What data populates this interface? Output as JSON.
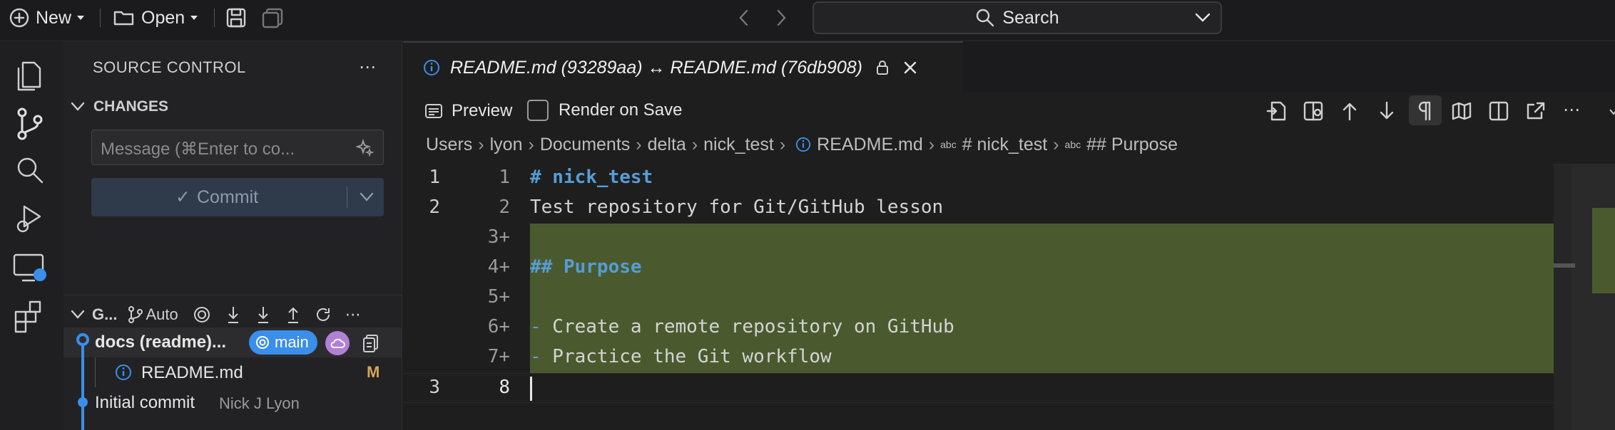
{
  "topbar": {
    "new_label": "New",
    "open_label": "Open",
    "search_label": "Search"
  },
  "sidebar": {
    "title": "SOURCE CONTROL",
    "changes_label": "CHANGES",
    "message_placeholder": "Message (⌘Enter to co...",
    "commit_label": "Commit",
    "graph_label": "G...",
    "auto_label": "Auto",
    "graph": {
      "commits": [
        {
          "title": "docs (readme)...",
          "branch": "main"
        },
        {
          "title": "Initial commit",
          "author": "Nick J Lyon"
        }
      ],
      "file": {
        "name": "README.md",
        "status": "M"
      }
    }
  },
  "editor": {
    "tab_title": "README.md (93289aa) ↔ README.md (76db908)",
    "toolbar": {
      "preview_label": "Preview",
      "render_on_save_label": "Render on Save"
    },
    "breadcrumbs": [
      "Users",
      "lyon",
      "Documents",
      "delta",
      "nick_test",
      "README.md",
      "# nick_test",
      "## Purpose"
    ],
    "lines": [
      {
        "left": "1",
        "right": "1",
        "text": "# nick_test",
        "added": false,
        "kind": "h1"
      },
      {
        "left": "2",
        "right": "2",
        "text": "Test repository for Git/GitHub lesson",
        "added": false,
        "kind": "plain"
      },
      {
        "left": "",
        "right": "3+",
        "text": "",
        "added": true,
        "kind": "plain"
      },
      {
        "left": "",
        "right": "4+",
        "text": "## Purpose",
        "added": true,
        "kind": "h1"
      },
      {
        "left": "",
        "right": "5+",
        "text": "",
        "added": true,
        "kind": "plain"
      },
      {
        "left": "",
        "right": "6+",
        "text": "- Create a remote repository on GitHub",
        "added": true,
        "kind": "bullet"
      },
      {
        "left": "",
        "right": "7+",
        "text": "- Practice the Git workflow",
        "added": true,
        "kind": "bullet"
      },
      {
        "left": "3",
        "right": "8",
        "text": "",
        "added": false,
        "kind": "plain"
      }
    ]
  },
  "colors": {
    "accent": "#3b8eea",
    "added_bg": "#4a5a2e",
    "heading": "#569cd6",
    "modified": "#d7a659",
    "cloud_badge": "#b180d7"
  }
}
